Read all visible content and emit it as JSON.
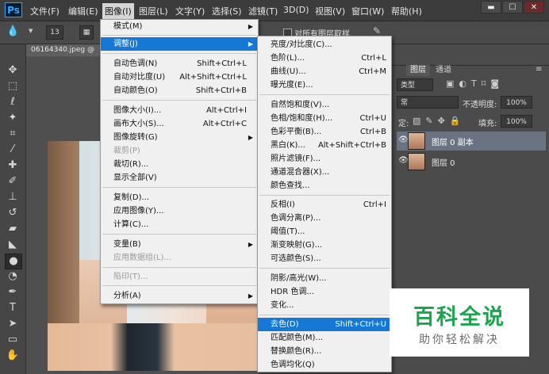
{
  "app": {
    "logo": "Ps"
  },
  "menubar": {
    "items": [
      "文件(F)",
      "编辑(E)",
      "图像(I)",
      "图层(L)",
      "文字(Y)",
      "选择(S)",
      "滤镜(T)",
      "3D(D)",
      "视图(V)",
      "窗口(W)",
      "帮助(H)"
    ],
    "active_index": 2,
    "window_buttons": [
      "▬",
      "☐",
      "✕"
    ]
  },
  "options_bar": {
    "brush_size": "13",
    "sample_all_layers_label": "对所有图层取样"
  },
  "document": {
    "tab_title": "06164340.jpeg @"
  },
  "image_menu": {
    "items": [
      {
        "label": "模式(M)",
        "shortcut": "",
        "submenu": true,
        "disabled": false
      },
      {
        "label": "调整(J)",
        "shortcut": "",
        "submenu": true,
        "disabled": false,
        "highlighted": true
      },
      {
        "label": "自动色调(N)",
        "shortcut": "Shift+Ctrl+L",
        "disabled": false
      },
      {
        "label": "自动对比度(U)",
        "shortcut": "Alt+Shift+Ctrl+L",
        "disabled": false
      },
      {
        "label": "自动颜色(O)",
        "shortcut": "Shift+Ctrl+B",
        "disabled": false
      },
      {
        "label": "图像大小(I)...",
        "shortcut": "Alt+Ctrl+I",
        "disabled": false
      },
      {
        "label": "画布大小(S)...",
        "shortcut": "Alt+Ctrl+C",
        "disabled": false
      },
      {
        "label": "图像旋转(G)",
        "shortcut": "",
        "submenu": true,
        "disabled": false
      },
      {
        "label": "裁剪(P)",
        "shortcut": "",
        "disabled": true
      },
      {
        "label": "裁切(R)...",
        "shortcut": "",
        "disabled": false
      },
      {
        "label": "显示全部(V)",
        "shortcut": "",
        "disabled": false
      },
      {
        "label": "复制(D)...",
        "shortcut": "",
        "disabled": false
      },
      {
        "label": "应用图像(Y)...",
        "shortcut": "",
        "disabled": false
      },
      {
        "label": "计算(C)...",
        "shortcut": "",
        "disabled": false
      },
      {
        "label": "变量(B)",
        "shortcut": "",
        "submenu": true,
        "disabled": false
      },
      {
        "label": "应用数据组(L)...",
        "shortcut": "",
        "disabled": true
      },
      {
        "label": "陷印(T)...",
        "shortcut": "",
        "disabled": true
      },
      {
        "label": "分析(A)",
        "shortcut": "",
        "submenu": true,
        "disabled": false
      }
    ]
  },
  "adjust_menu": {
    "items": [
      {
        "label": "亮度/对比度(C)...",
        "shortcut": ""
      },
      {
        "label": "色阶(L)...",
        "shortcut": "Ctrl+L"
      },
      {
        "label": "曲线(U)...",
        "shortcut": "Ctrl+M"
      },
      {
        "label": "曝光度(E)...",
        "shortcut": ""
      },
      {
        "label": "自然饱和度(V)...",
        "shortcut": ""
      },
      {
        "label": "色相/饱和度(H)...",
        "shortcut": "Ctrl+U"
      },
      {
        "label": "色彩平衡(B)...",
        "shortcut": "Ctrl+B"
      },
      {
        "label": "黑白(K)...",
        "shortcut": "Alt+Shift+Ctrl+B"
      },
      {
        "label": "照片滤镜(F)...",
        "shortcut": ""
      },
      {
        "label": "通道混合器(X)...",
        "shortcut": ""
      },
      {
        "label": "颜色查找...",
        "shortcut": ""
      },
      {
        "label": "反相(I)",
        "shortcut": "Ctrl+I"
      },
      {
        "label": "色调分离(P)...",
        "shortcut": ""
      },
      {
        "label": "阈值(T)...",
        "shortcut": ""
      },
      {
        "label": "渐变映射(G)...",
        "shortcut": ""
      },
      {
        "label": "可选颜色(S)...",
        "shortcut": ""
      },
      {
        "label": "阴影/高光(W)...",
        "shortcut": ""
      },
      {
        "label": "HDR 色调...",
        "shortcut": ""
      },
      {
        "label": "变化...",
        "shortcut": ""
      },
      {
        "label": "去色(D)",
        "shortcut": "Shift+Ctrl+U",
        "highlighted": true
      },
      {
        "label": "匹配颜色(M)...",
        "shortcut": ""
      },
      {
        "label": "替换颜色(R)...",
        "shortcut": ""
      },
      {
        "label": "色调均化(Q)",
        "shortcut": ""
      }
    ]
  },
  "layers_panel": {
    "tabs": [
      "图层",
      "通道"
    ],
    "kind_filter": "类型",
    "blend_mode": "常",
    "opacity_label": "不透明度:",
    "opacity_value": "100%",
    "fill_label": "填充:",
    "fill_value": "100%",
    "lock_label": "定:",
    "layers": [
      {
        "name": "图层 0 副本",
        "selected": true
      },
      {
        "name": "图层 0",
        "selected": false
      }
    ]
  },
  "watermark": {
    "title": "百科全说",
    "subtitle": "助你轻松解决",
    "title_color": "#1aa64a"
  },
  "colors": {
    "highlight": "#1478d4",
    "menu_bg": "#f0f0f0",
    "ui_dark": "#3c3c3c"
  }
}
